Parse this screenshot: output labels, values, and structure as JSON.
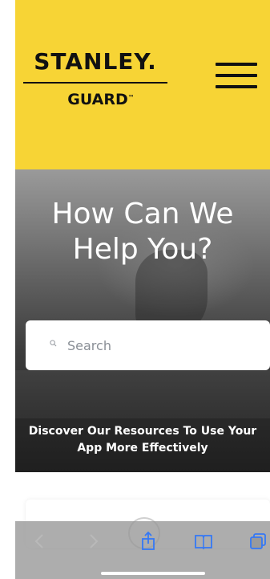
{
  "header": {
    "logo_brand": "STANLEY.",
    "logo_sub": "GUARD",
    "logo_tm": "™",
    "background_color": "#f7d435"
  },
  "hero": {
    "title": "How Can We Help You?",
    "search_placeholder": "Search",
    "subtitle": "Discover Our Resources To Use Your App More Effectively"
  },
  "icons": {
    "menu": "hamburger-menu-icon",
    "search": "search-icon",
    "back": "chevron-left-icon",
    "forward": "chevron-right-icon",
    "share": "share-icon",
    "bookmarks": "book-icon",
    "tabs": "tabs-icon"
  },
  "colors": {
    "accent_blue": "#3478f6",
    "disabled_gray": "#b9b9b9"
  }
}
